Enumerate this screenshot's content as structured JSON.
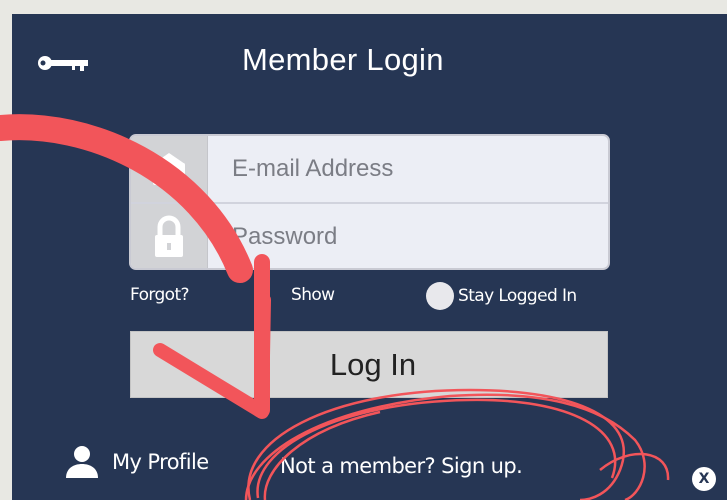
{
  "header": {
    "title": "Member Login",
    "key_icon": "key-icon"
  },
  "form": {
    "email": {
      "placeholder": "E-mail Address",
      "value": "",
      "icon": "envelope-icon"
    },
    "password": {
      "placeholder": "Password",
      "value": "",
      "icon": "padlock-icon"
    }
  },
  "options": {
    "forgot_label": "Forgot?",
    "show_label": "Show",
    "stay_logged_in_label": "Stay Logged In"
  },
  "login_button_label": "Log In",
  "footer": {
    "profile_label": "My Profile",
    "profile_icon": "user-icon",
    "signup_label": "Not a member? Sign up.",
    "close_label": "X"
  },
  "colors": {
    "panel_bg": "#263654",
    "button_bg": "#d8d8d8",
    "annotation_red": "#f2555a"
  }
}
